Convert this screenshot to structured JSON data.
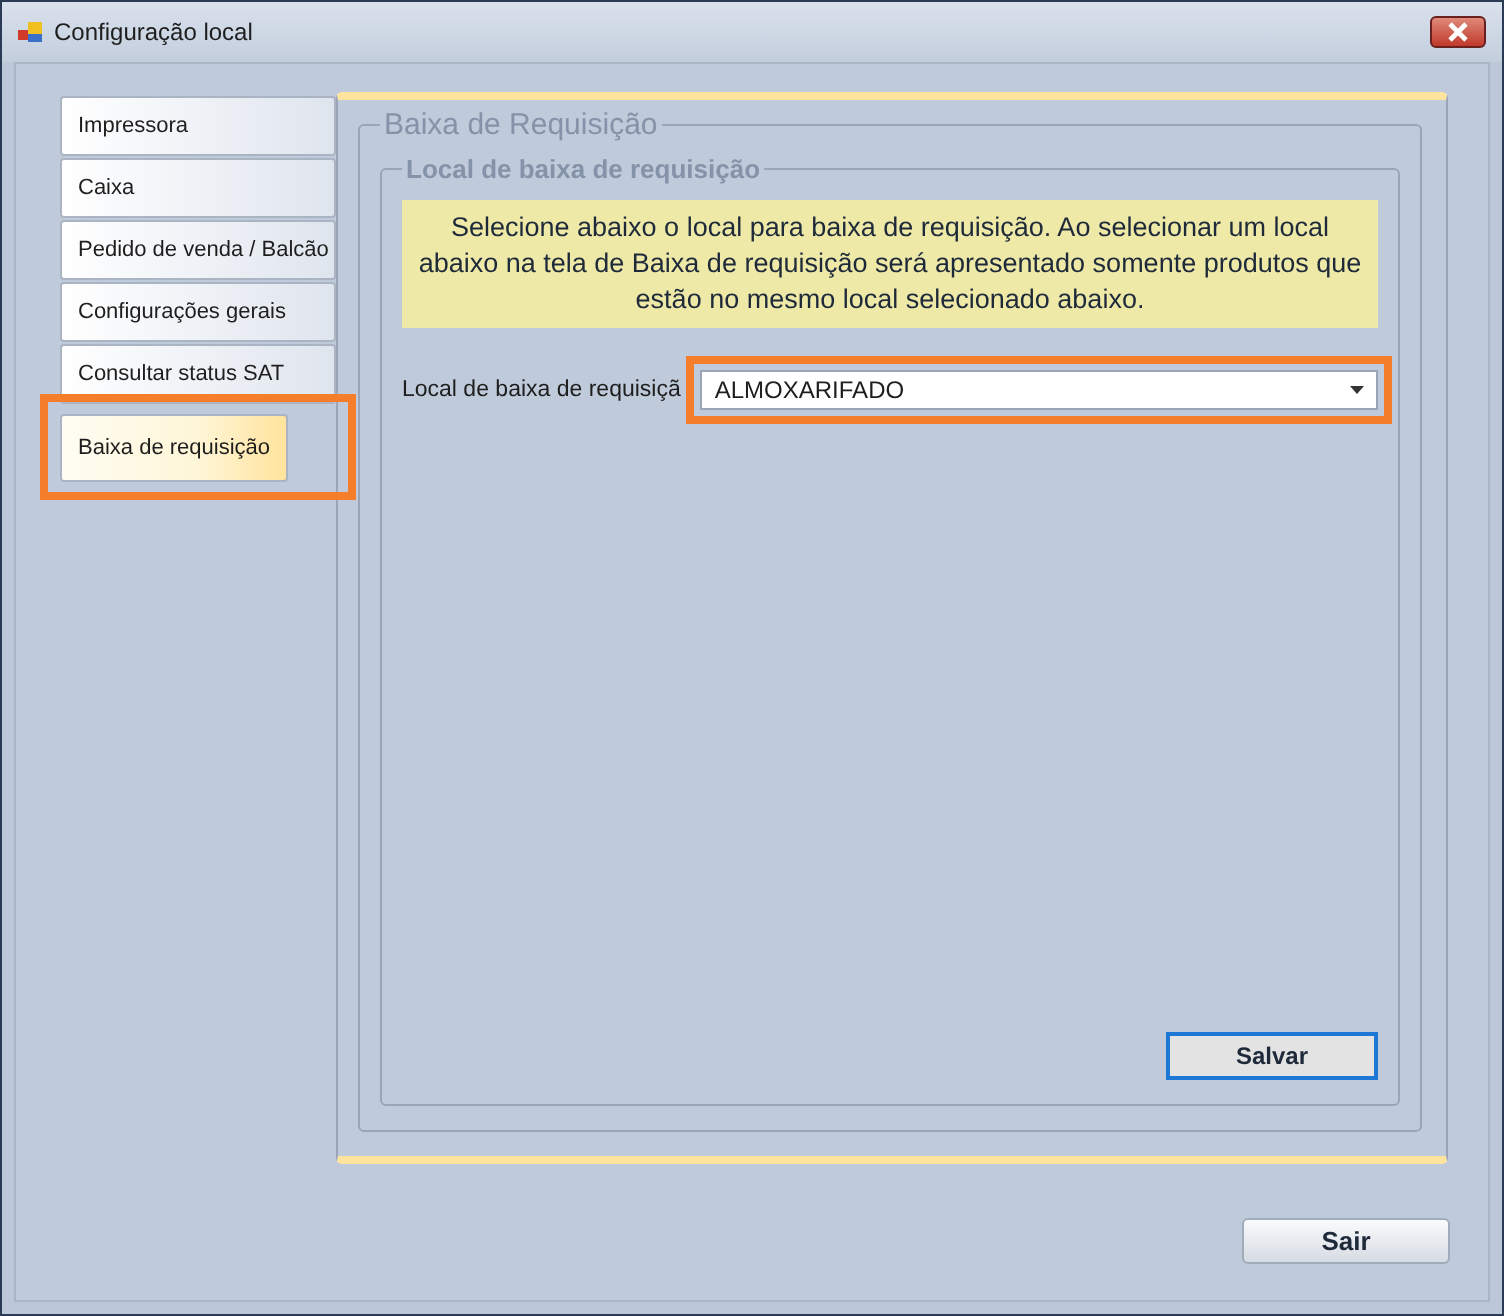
{
  "window": {
    "title": "Configuração local"
  },
  "tabs": [
    {
      "label": "Impressora",
      "selected": false,
      "highlighted": false
    },
    {
      "label": "Caixa",
      "selected": false,
      "highlighted": false
    },
    {
      "label": "Pedido de venda / Balcão",
      "selected": false,
      "highlighted": false
    },
    {
      "label": "Configurações gerais",
      "selected": false,
      "highlighted": false
    },
    {
      "label": "Consultar status SAT",
      "selected": false,
      "highlighted": false
    },
    {
      "label": "Baixa de requisição",
      "selected": true,
      "highlighted": true
    }
  ],
  "panel": {
    "title": "Baixa de Requisição",
    "group": {
      "title": "Local de baixa de requisição",
      "note": "Selecione abaixo o local para baixa de requisição. Ao selecionar um local abaixo na tela de Baixa de requisição será apresentado somente produtos que estão no mesmo local selecionado abaixo.",
      "field_label": "Local de baixa de requisiçã",
      "dropdown": {
        "value": "ALMOXARIFADO",
        "highlighted": true
      },
      "save_button": "Salvar"
    }
  },
  "exit_button": "Sair"
}
